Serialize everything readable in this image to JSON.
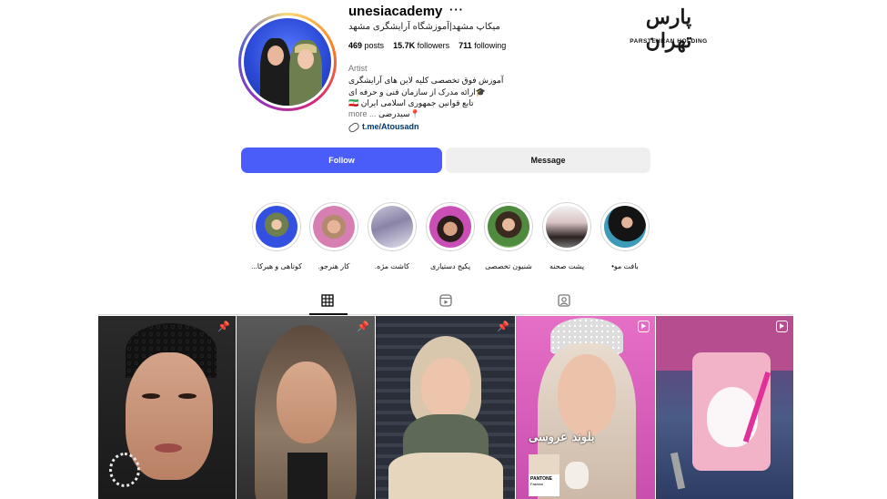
{
  "profile": {
    "username": "unesiacademy",
    "more": "···",
    "full_name": "میکاپ مشهد|آموزشگاه آرایشگری مشهد",
    "stats": {
      "posts_value": "469",
      "posts_label": "posts",
      "followers_value": "15.7K",
      "followers_label": "followers",
      "following_value": "711",
      "following_label": "following"
    },
    "category": "Artist",
    "bio_lines": [
      "آموزش فوق تخصصی کلیه لاین های آرایشگری",
      "🎓ارائه مدرک از سازمان فنی و حرفه ای",
      "تابع قوانین جمهوری اسلامی ایران 🇮🇷",
      "📍سیدرضی"
    ],
    "bio_more": "... more",
    "link": "t.me/Atousadn"
  },
  "watermark": {
    "script": "پارس تهران",
    "sub": "PARSTEHRAN HOLDING"
  },
  "actions": {
    "follow": "Follow",
    "message": "Message"
  },
  "highlights": [
    {
      "label": "کوتاهی و هیرکا..."
    },
    {
      "label": "کار هنرجو."
    },
    {
      "label": "کاشت مژه."
    },
    {
      "label": "پکیج دستیاری"
    },
    {
      "label": "شنیون تخصصی"
    },
    {
      "label": "پشت صحنه"
    },
    {
      "label": "بافت مو•"
    }
  ],
  "tabs": {
    "active": "posts",
    "items": [
      "posts-grid",
      "reels",
      "tagged"
    ]
  },
  "posts": [
    {
      "type": "pinned"
    },
    {
      "type": "pinned"
    },
    {
      "type": "pinned"
    },
    {
      "type": "reel",
      "overlay_text": "بلوند عروسی",
      "pantone_title": "PANTONE",
      "pantone_sub": "Fashion"
    },
    {
      "type": "reel"
    }
  ],
  "colors": {
    "follow_button": "#4a5df9",
    "link": "#00376b",
    "muted": "#737373"
  }
}
